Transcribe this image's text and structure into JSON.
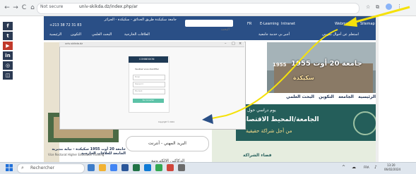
{
  "browser": {
    "warning": "Not secure",
    "url": "univ-skikda.dz/index.php/ar",
    "back": "←",
    "forward": "→",
    "reload": "C",
    "home": "⌂"
  },
  "social": [
    "f",
    "t",
    "▶",
    "in",
    "◎",
    "◫"
  ],
  "header": {
    "address": "جامعة سكيكدة طريق الحدائق - سكيكدة - الجزائر",
    "phone": "+213 38 72 31 83",
    "search_placeholder": "البحث",
    "top_nav": [
      "FR",
      "E-Learning",
      "Intranet",
      "Webmail",
      "Sitemap"
    ],
    "main_nav": [
      "الرئيسية",
      "التكوين",
      "البحث العلمي",
      "العلاقات الخارجية",
      "أجبر بي خدمة جامعية",
      "استعلم عن أحوال تكويني"
    ]
  },
  "slideshow": {
    "headline": "جامعة 20 أوت 1955",
    "year": "1955",
    "city": "سكيكدة"
  },
  "content_nav": [
    "الرئيسية",
    "الجامعة",
    "التكوين",
    "البحث العلمي"
  ],
  "promo": {
    "line1": "يوم دراسي حول",
    "line2": "الجامعة/المحيط الاقتصادي",
    "line3": "من أجل شراكة حقيقية",
    "line4": "فضاء الشراكة"
  },
  "email_button": "البريد المهني - أنترنت",
  "elearn_label": "الدكاكين الإلكترونية",
  "news": {
    "title": "جامعة 20 أوت 1955 سكيكدة - نيابة مديرية الجامعة للعلاقات الخارجية",
    "subtitle": "Vice Rectorat Higher Education Training"
  },
  "login_window": {
    "tab": "univ-skikda.dz",
    "card_title": "CONNEXION",
    "prompt": "Veuillez vous identifier",
    "username_placeholder": "Email",
    "password_placeholder": "Password",
    "role_placeholder": "Etudiant",
    "submit": "Se connecter",
    "footer": "Copyright © 2024"
  },
  "taskbar": {
    "search": "Rechercher",
    "lang": "FRA",
    "time": "13:20",
    "date": "06/02/2024"
  },
  "colors": {
    "header": "#2a4f86",
    "arrow": "#f5e10a",
    "login_head": "#1f3a55",
    "login_submit": "#5cc2a7",
    "promo": "#245e5a"
  }
}
